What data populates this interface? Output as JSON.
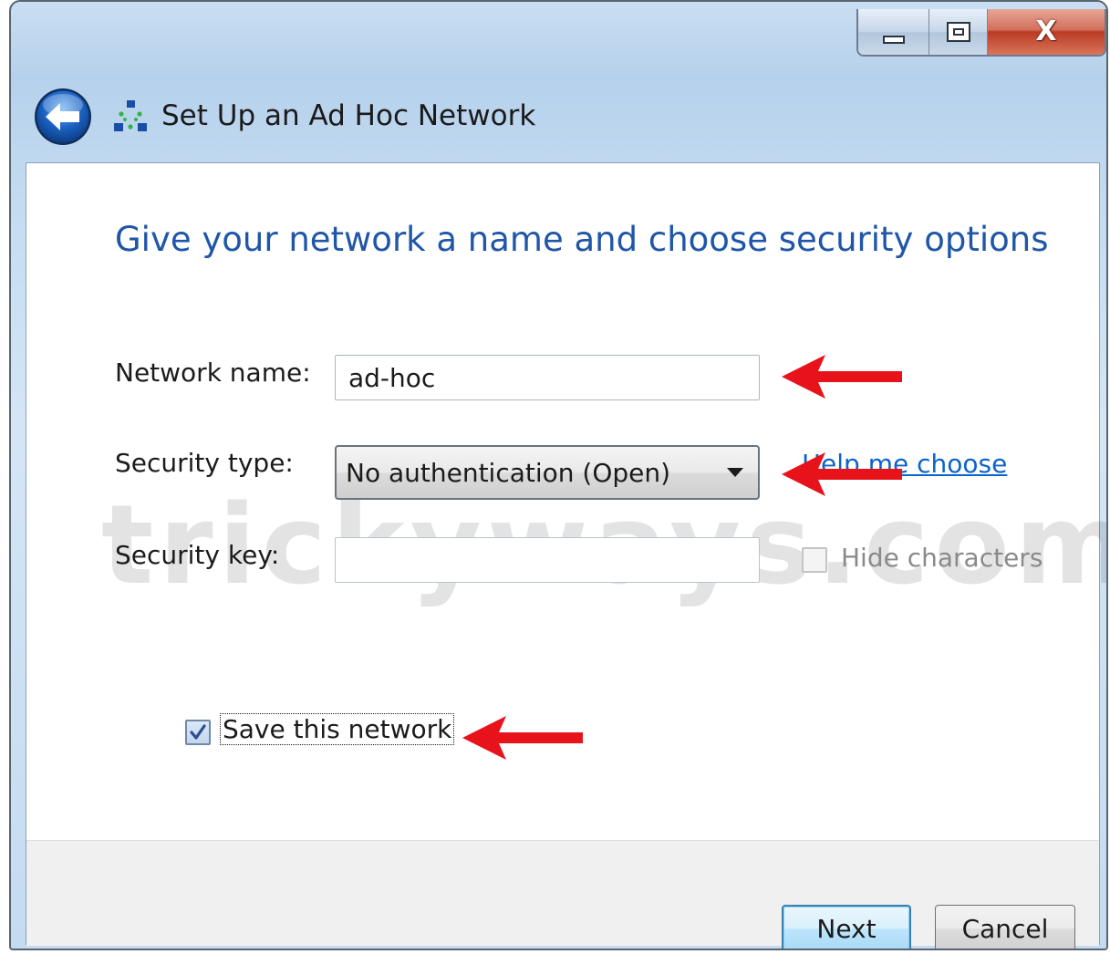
{
  "window": {
    "title": "Set Up an Ad Hoc Network",
    "caption_buttons": {
      "minimize_icon": "minimize-icon",
      "maximize_icon": "maximize-icon",
      "close_glyph": "X"
    },
    "back_icon": "back-arrow-icon",
    "app_icon": "network-icon"
  },
  "content": {
    "heading": "Give your network a name and choose security options",
    "network_name": {
      "label": "Network name:",
      "value": "ad-hoc"
    },
    "security_type": {
      "label": "Security type:",
      "value": "No authentication (Open)",
      "help_link": "Help me choose"
    },
    "security_key": {
      "label": "Security key:",
      "value": "",
      "hide_characters": {
        "label": "Hide characters",
        "checked": false,
        "enabled": false
      },
      "enabled": false
    },
    "save_network": {
      "label": "Save this network",
      "checked": true
    },
    "watermark": "trickyways.com"
  },
  "buttons": {
    "next": "Next",
    "cancel": "Cancel"
  },
  "annotations": {
    "arrow_color": "#e8121a"
  },
  "colors": {
    "heading": "#1f56a8",
    "link": "#0c63c9",
    "frame": "#c3dbf1"
  }
}
